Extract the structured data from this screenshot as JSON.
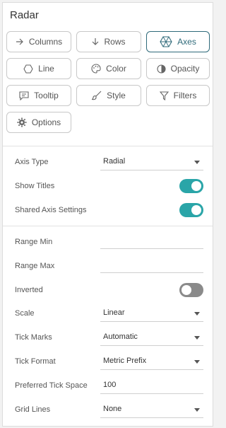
{
  "panel": {
    "title": "Radar"
  },
  "buttons": {
    "columns": "Columns",
    "rows": "Rows",
    "axes": "Axes",
    "line": "Line",
    "color": "Color",
    "opacity": "Opacity",
    "tooltip": "Tooltip",
    "style": "Style",
    "filters": "Filters",
    "options": "Options",
    "active": "axes"
  },
  "settings": {
    "axis_type": {
      "label": "Axis Type",
      "value": "Radial"
    },
    "show_titles": {
      "label": "Show Titles",
      "on": true
    },
    "shared_axis": {
      "label": "Shared Axis Settings",
      "on": true
    },
    "range_min": {
      "label": "Range Min",
      "value": ""
    },
    "range_max": {
      "label": "Range Max",
      "value": ""
    },
    "inverted": {
      "label": "Inverted",
      "on": false
    },
    "scale": {
      "label": "Scale",
      "value": "Linear"
    },
    "tick_marks": {
      "label": "Tick Marks",
      "value": "Automatic"
    },
    "tick_format": {
      "label": "Tick Format",
      "value": "Metric Prefix"
    },
    "tick_space": {
      "label": "Preferred Tick Space",
      "value": "100"
    },
    "grid_lines": {
      "label": "Grid Lines",
      "value": "None"
    }
  },
  "colors": {
    "accent": "#2aa5a8",
    "active_border": "#2f6a7a",
    "toggle_off": "#8a8a8a"
  }
}
